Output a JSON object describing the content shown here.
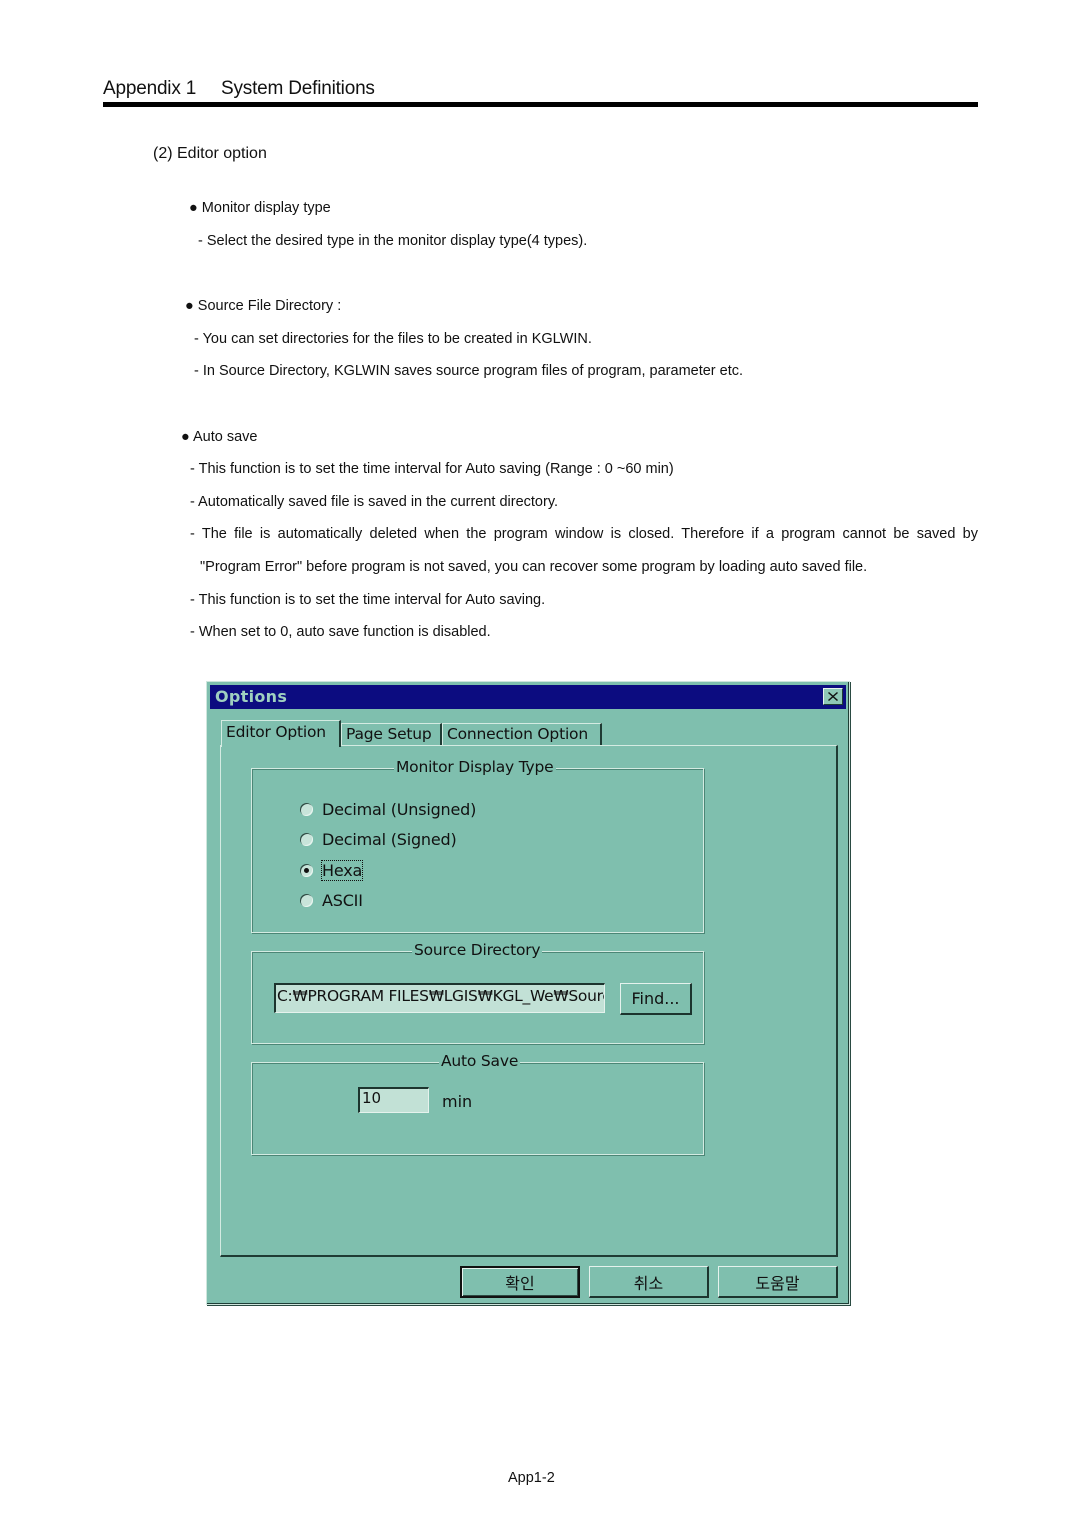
{
  "header": {
    "left": "Appendix 1",
    "right": "System Definitions"
  },
  "section_title": "(2) Editor option",
  "sections": [
    {
      "bullet": "Monitor display type",
      "lines": [
        "- Select the desired type in the monitor display type(4 types)."
      ]
    },
    {
      "bullet": "Source File Directory :",
      "lines": [
        "- You can set directories for the files to be created in KGLWIN.",
        "- In Source Directory, KGLWIN saves source program files of program, parameter etc."
      ]
    },
    {
      "bullet": "Auto save",
      "lines": [
        "- This function is to set the time interval for Auto saving (Range : 0 ~60 min)",
        "- Automatically saved file is saved in the current directory.",
        "- The file is automatically deleted when the program window is closed. Therefore if a program cannot be saved by",
        "\"Program Error\" before program is not saved, you can recover some program by loading auto saved file.",
        "- This function is to set the time interval for Auto saving.",
        "- When set to 0, auto save function is disabled."
      ]
    }
  ],
  "dialog": {
    "title": "Options",
    "close_icon": "close-icon",
    "tabs": [
      {
        "label": "Editor Option",
        "active": true
      },
      {
        "label": "Page Setup",
        "active": false
      },
      {
        "label": "Connection Option",
        "active": false
      }
    ],
    "monitor_display_type": {
      "label": "Monitor Display Type",
      "options": [
        {
          "label": "Decimal (Unsigned)",
          "checked": false
        },
        {
          "label": "Decimal (Signed)",
          "checked": false
        },
        {
          "label": "Hexa",
          "checked": true
        },
        {
          "label": "ASCII",
          "checked": false
        }
      ]
    },
    "source_directory": {
      "label": "Source Directory",
      "value": "C:₩PROGRAM FILES₩LGIS₩KGL_We₩Source",
      "find_button": "Find..."
    },
    "auto_save": {
      "label": "Auto Save",
      "value": "10",
      "unit": "min"
    },
    "buttons": {
      "ok": "확인",
      "cancel": "취소",
      "help": "도움말"
    }
  },
  "page_number": "App1-2",
  "colors": {
    "dialog_bg": "#7fbfae",
    "titlebar": "#0c0c80",
    "input_bg": "#c2e1d6"
  }
}
